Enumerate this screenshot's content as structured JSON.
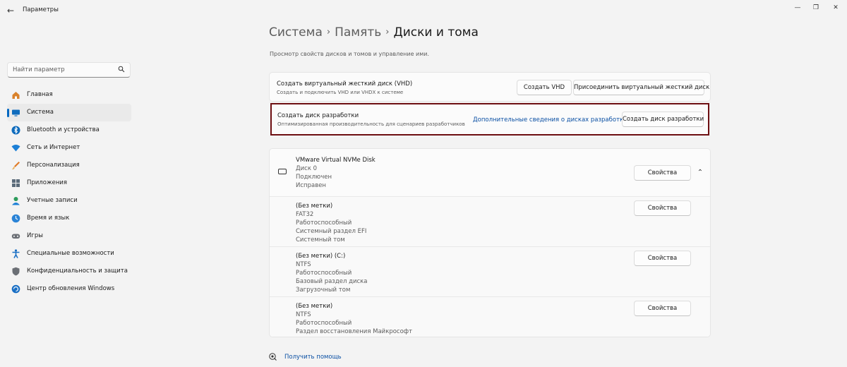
{
  "app": {
    "title": "Параметры",
    "back_glyph": "←",
    "window_controls": {
      "minimize": "—",
      "maximize": "❐",
      "close": "✕"
    }
  },
  "search": {
    "placeholder": "Найти параметр",
    "icon": "search-icon"
  },
  "sidebar": {
    "items": [
      {
        "label": "Главная",
        "icon": "home-icon",
        "color": "#d9822b",
        "active": false
      },
      {
        "label": "Система",
        "icon": "monitor-icon",
        "color": "#0f6cbd",
        "active": true
      },
      {
        "label": "Bluetooth и устройства",
        "icon": "bluetooth-icon",
        "color": "#0f6cbd",
        "active": false
      },
      {
        "label": "Сеть и Интернет",
        "icon": "wifi-icon",
        "color": "#1c7fd6",
        "active": false
      },
      {
        "label": "Персонализация",
        "icon": "brush-icon",
        "color": "#e07a26",
        "active": false
      },
      {
        "label": "Приложения",
        "icon": "apps-icon",
        "color": "#5b6b7a",
        "active": false
      },
      {
        "label": "Учетные записи",
        "icon": "person-icon",
        "color": "#2c9b5b",
        "active": false
      },
      {
        "label": "Время и язык",
        "icon": "globe-clock-icon",
        "color": "#2a83d6",
        "active": false
      },
      {
        "label": "Игры",
        "icon": "gamepad-icon",
        "color": "#6b6f75",
        "active": false
      },
      {
        "label": "Специальные возможности",
        "icon": "accessibility-icon",
        "color": "#1a6fc4",
        "active": false
      },
      {
        "label": "Конфиденциальность и защита",
        "icon": "shield-icon",
        "color": "#6b6f75",
        "active": false
      },
      {
        "label": "Центр обновления Windows",
        "icon": "update-icon",
        "color": "#1a6fc4",
        "active": false
      }
    ]
  },
  "breadcrumb": {
    "part1": "Система",
    "part2": "Память",
    "current": "Диски и тома",
    "separator": "›"
  },
  "page_description": "Просмотр свойств дисков и томов и управление ими.",
  "vhd": {
    "title": "Создать виртуальный жесткий диск (VHD)",
    "subtitle": "Создать и подключить VHD или VHDX к системе",
    "create_button": "Создать VHD",
    "attach_button": "Присоединить виртуальный жесткий диск"
  },
  "dev_drive": {
    "title": "Создать диск разработки",
    "subtitle": "Оптимизированная производительность для сценариев разработчиков",
    "link": "Дополнительные сведения о дисках разработки.",
    "button": "Создать диск разработки",
    "highlight_color": "#6d0f12"
  },
  "disk": {
    "name": "VMware Virtual NVMe Disk",
    "number": "Диск 0",
    "state": "Подключен",
    "health": "Исправен",
    "properties_button": "Свойства",
    "chevron": "⌃",
    "volumes": [
      {
        "label": "(Без метки)",
        "fs": "FAT32",
        "status": "Работоспособный",
        "type": "Системный раздел EFI",
        "role": "Системный том",
        "button": "Свойства"
      },
      {
        "label": "(Без метки) (C:)",
        "fs": "NTFS",
        "status": "Работоспособный",
        "type": "Базовый раздел диска",
        "role": "Загрузочный том",
        "button": "Свойства"
      },
      {
        "label": "(Без метки)",
        "fs": "NTFS",
        "status": "Работоспособный",
        "type": "Раздел восстановления Майкрософт",
        "button": "Свойства"
      }
    ]
  },
  "help": {
    "label": "Получить помощь",
    "icon": "help-icon"
  }
}
